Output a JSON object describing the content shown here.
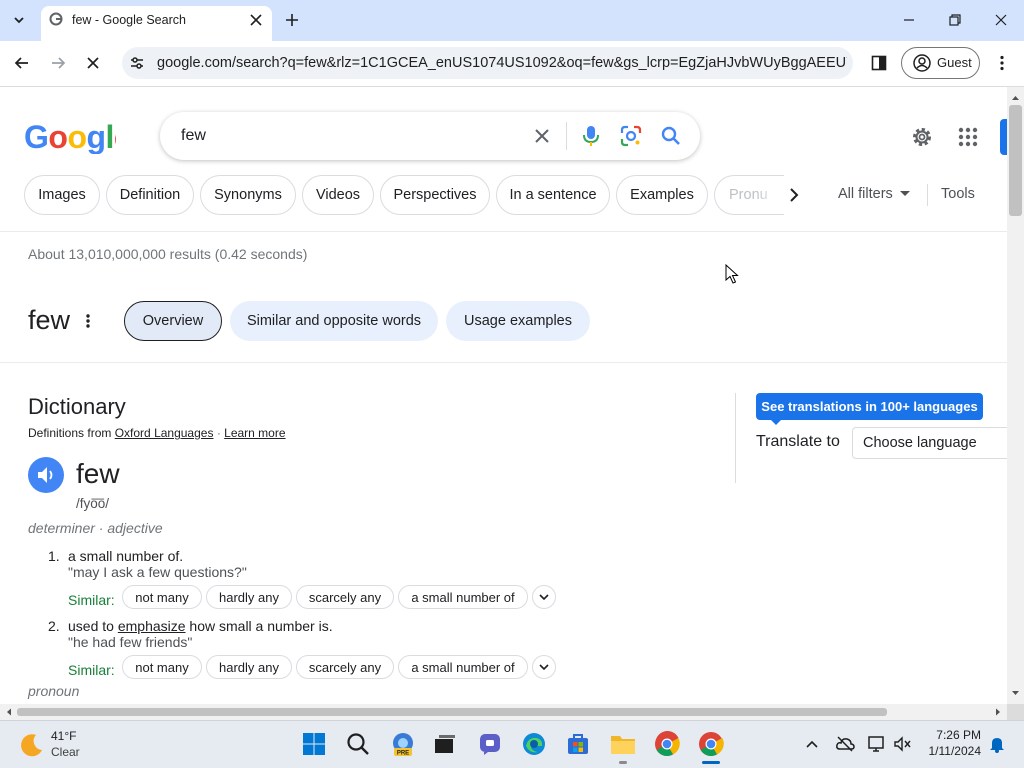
{
  "browser": {
    "tab_title": "few - Google Search",
    "url": "google.com/search?q=few&rlz=1C1GCEA_enUS1074US1092&oq=few&gs_lcrp=EgZjaHJvbWUyBggAEEUYO...",
    "profile_label": "Guest"
  },
  "search": {
    "query": "few",
    "filters": [
      "Images",
      "Definition",
      "Synonyms",
      "Videos",
      "Perspectives",
      "In a sentence",
      "Examples",
      "Pronu"
    ],
    "all_filters": "All filters",
    "tools": "Tools",
    "stats": "About 13,010,000,000 results (0.42 seconds)"
  },
  "word_panel": {
    "word": "few",
    "tabs": [
      "Overview",
      "Similar and opposite words",
      "Usage examples"
    ]
  },
  "dictionary": {
    "heading": "Dictionary",
    "source_prefix": "Definitions from",
    "source_name": "Oxford Languages",
    "separator": "·",
    "learn_more": "Learn more",
    "headword": "few",
    "phonetic": "/fyo͞o/",
    "pos1": "determiner · adjective",
    "senses": [
      {
        "num": "1.",
        "def": "a small number of.",
        "example": "\"may I ask a few questions?\"",
        "similar_label": "Similar:",
        "similar": [
          "not many",
          "hardly any",
          "scarcely any",
          "a small number of"
        ]
      },
      {
        "num": "2.",
        "def_pre": "used to",
        "def_link": "emphasize",
        "def_post": "how small a number is.",
        "example": "\"he had few friends\"",
        "similar_label": "Similar:",
        "similar": [
          "not many",
          "hardly any",
          "scarcely any",
          "a small number of"
        ]
      }
    ],
    "pos2": "pronoun"
  },
  "translate": {
    "button": "See translations in 100+ languages",
    "label": "Translate to",
    "select_value": "Choose language"
  },
  "taskbar": {
    "temperature": "41°F",
    "condition": "Clear",
    "time": "7:26 PM",
    "date": "1/11/2024"
  },
  "colors": {
    "accent": "#1a73e8",
    "tabstrip": "#d3e3fd",
    "similar_green": "#188038"
  }
}
